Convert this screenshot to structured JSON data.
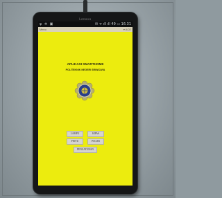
{
  "device": {
    "brand": "Lenovo",
    "status_left": "ψ ✲ ▣",
    "status_right": "✉ ᯤ ıll ıll 49 ▭ 16.31"
  },
  "action_bar": {
    "title": "Menu",
    "menu": "▾ ACE"
  },
  "app": {
    "title": "APLIKASI SMARTHOME",
    "subtitle": "POLITEKNIK NEGERI SRIWIJAYA",
    "logo_icon": "university-emblem-icon",
    "buttons": {
      "lampu": "LAMPU",
      "kipas": "KIPAS",
      "pintu": "PINTU",
      "pagar": "PAGAR",
      "pengaturan": "PENGATURAN"
    }
  },
  "colors": {
    "screen_background": "#ecec0e",
    "button_background": "#d6d4cf",
    "phone_body": "#151617"
  }
}
